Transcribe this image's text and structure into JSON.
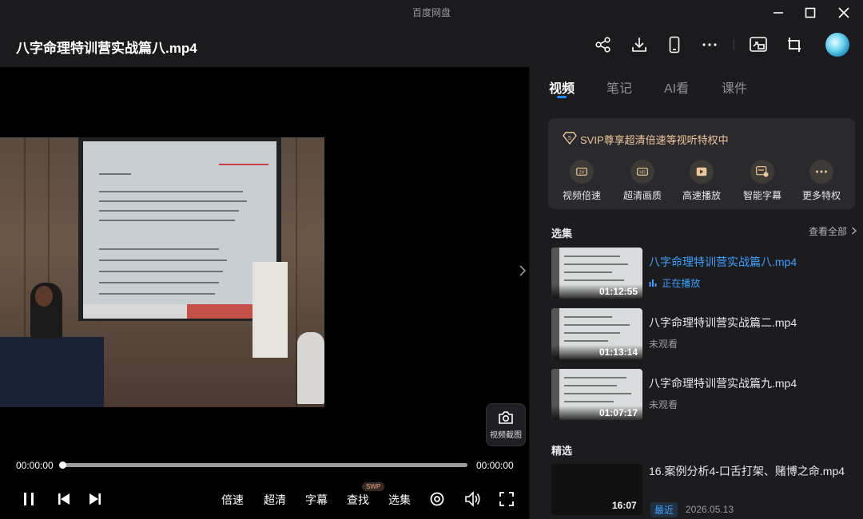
{
  "app": {
    "name": "百度网盘"
  },
  "file": {
    "title": "八字命理特训营实战篇八.mp4"
  },
  "toolbar": {
    "icons": [
      "share-icon",
      "download-icon",
      "phone-icon",
      "more-icon",
      "screen-cast-icon",
      "pip-icon"
    ]
  },
  "player": {
    "current_time": "00:00:00",
    "total_time": "00:00:00",
    "progress": 0,
    "snapshot_label": "视频截图",
    "controls": {
      "speed": "倍速",
      "quality": "超清",
      "subtitle": "字幕",
      "search": "查找",
      "search_badge": "SWP",
      "episodes": "选集"
    }
  },
  "side": {
    "tabs": [
      "视频",
      "笔记",
      "AI看",
      "课件"
    ],
    "active_tab": 0,
    "svip": {
      "title": "SVIP尊享超清倍速等视听特权中",
      "perks": [
        {
          "label": "视频倍速",
          "icon": "speed-icon"
        },
        {
          "label": "超清画质",
          "icon": "hd-icon"
        },
        {
          "label": "高速播放",
          "icon": "fast-play-icon"
        },
        {
          "label": "智能字幕",
          "icon": "smart-subtitle-icon"
        },
        {
          "label": "更多特权",
          "icon": "more-perks-icon"
        }
      ]
    },
    "episodes_title": "选集",
    "view_all": "查看全部",
    "episodes": [
      {
        "name": "八字命理特训营实战篇八.mp4",
        "duration": "01:12:55",
        "status": "正在播放",
        "playing": true
      },
      {
        "name": "八字命理特训营实战篇二.mp4",
        "duration": "01:13:14",
        "status": "未观看",
        "playing": false
      },
      {
        "name": "八字命理特训营实战篇九.mp4",
        "duration": "01:07:17",
        "status": "未观看",
        "playing": false
      }
    ],
    "picks_title": "精选",
    "pick": {
      "name": "16.案例分析4-口舌打架、赌博之命.mp4",
      "duration": "16:07",
      "tag": "最近",
      "date": "2026.05.13"
    }
  },
  "colors": {
    "accent": "#1e8bff",
    "gold": "#f0c79a"
  }
}
